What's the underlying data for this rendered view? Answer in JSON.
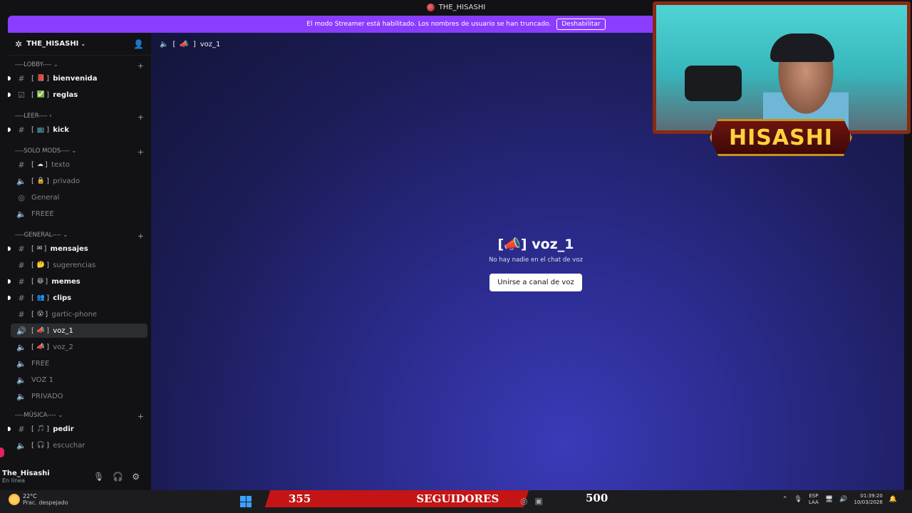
{
  "window": {
    "title": "THE_HISASHI"
  },
  "streamer_bar": {
    "message": "El modo Streamer está habilitado. Los nombres de usuario se han truncado.",
    "button": "Deshabilitar"
  },
  "server": {
    "name": "THE_HISASHI"
  },
  "categories": {
    "lobby": "----LOBBY----",
    "leer": "----LEER----",
    "solo_mods": "----SOLO MODS----",
    "general": "----GENERAL----",
    "musica": "----MÚSICA----"
  },
  "channels": {
    "bienvenida": "bienvenida",
    "reglas": "reglas",
    "kick": "kick",
    "texto": "texto",
    "privado": "privado",
    "general": "General",
    "freee": "FREEE",
    "mensajes": "mensajes",
    "sugerencias": "sugerencias",
    "memes": "memes",
    "clips": "clips",
    "gartic": "gartic-phone",
    "voz_1": "voz_1",
    "voz_2": "voz_2",
    "free": "FREE",
    "voz1": "VOZ 1",
    "privado2": "PRIVADO",
    "pedir": "pedir",
    "escuchar": "escuchar"
  },
  "user": {
    "name": "The_Hisashi",
    "status": "En línea"
  },
  "main": {
    "header_channel": "voz_1",
    "title": "voz_1",
    "subtitle": "No hay nadie en el chat de voz",
    "join_button": "Unirse a canal de voz"
  },
  "overlay": {
    "name_banner": "HISASHI",
    "followers_count": "355",
    "followers_label": "SEGUIDORES",
    "goal": "500"
  },
  "taskbar": {
    "temp": "22°C",
    "condition": "Prac. despejado",
    "lang_1": "ESP",
    "lang_2": "LAA",
    "time": "01:39:20",
    "date": "10/03/2026"
  }
}
